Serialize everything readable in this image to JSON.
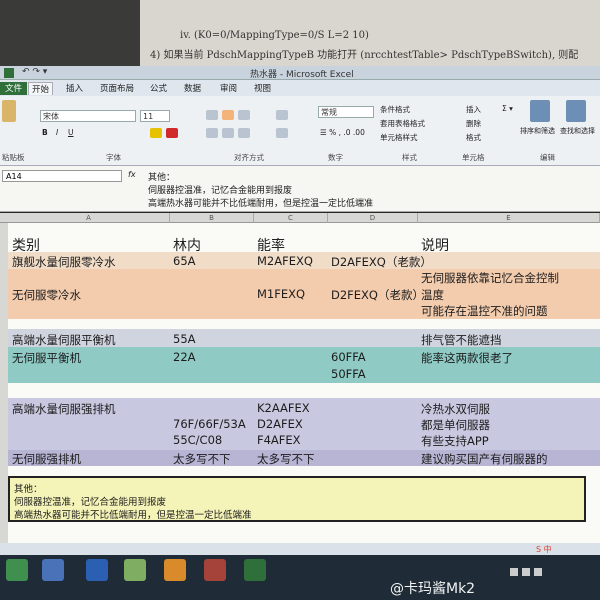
{
  "word": {
    "line1": "iv.       (K0=0/MappingType=0/S L=2 10)",
    "line2": "4) 如果当前 PdschMappingTypeB 功能打开 (nrcchtestTable> PdschTypeBSwitch), 则配"
  },
  "excel": {
    "title": "热水器 - Microsoft Excel",
    "tabs": [
      "文件",
      "开始",
      "插入",
      "页面布局",
      "公式",
      "数据",
      "审阅",
      "视图"
    ],
    "font_name": "宋体",
    "font_size": "11",
    "number_format": "常规",
    "ribbon_items": {
      "cond_format": "条件格式",
      "table_format": "套用表格格式",
      "cell_style": "单元格样式",
      "insert": "插入",
      "delete": "删除",
      "format": "格式",
      "sort_filter": "排序和筛选",
      "find_select": "查找和选择"
    },
    "groups": [
      "粘贴板",
      "字体",
      "对齐方式",
      "数字",
      "样式",
      "单元格",
      "编辑"
    ],
    "name_box": "A14",
    "fx": "fx",
    "formula_lines": [
      "其他：",
      "伺服器控温准，记忆合金能用到报废",
      "高端热水器可能并不比低端耐用，但是控温一定比低端准"
    ],
    "columns": [
      "A",
      "B",
      "C",
      "D",
      "E"
    ]
  },
  "table": {
    "headers": [
      "类别",
      "林内",
      "能率",
      "",
      "说明"
    ],
    "rows": [
      {
        "cat": "旗舰水量伺服零冷水",
        "b": "65A",
        "c": "M2AFEXQ",
        "d": "D2AFEXQ（老款）",
        "e": ""
      },
      {
        "cat": "",
        "b": "",
        "c": "",
        "d": "",
        "e": "无伺服器依靠记忆合金控制"
      },
      {
        "cat": "无伺服零冷水",
        "b": "",
        "c": "M1FEXQ",
        "d": "D2FEXQ（老款）",
        "e": "温度"
      },
      {
        "cat": "",
        "b": "",
        "c": "",
        "d": "",
        "e": "可能存在温控不准的问题"
      },
      {
        "cat": "高端水量伺服平衡机",
        "b": "55A",
        "c": "",
        "d": "",
        "e": "排气管不能遮挡"
      },
      {
        "cat": "无伺服平衡机",
        "b": "22A",
        "c": "",
        "d": "60FFA",
        "e": "能率这两款很老了"
      },
      {
        "cat": "",
        "b": "",
        "c": "",
        "d": "50FFA",
        "e": ""
      },
      {
        "cat": "高端水量伺服强排机",
        "b": "",
        "c": "K2AAFEX",
        "d": "",
        "e": "冷热水双伺服"
      },
      {
        "cat": "",
        "b": "76F/66F/53A",
        "c": "D2AFEX",
        "d": "",
        "e": "都是单伺服器"
      },
      {
        "cat": "",
        "b": "55C/C08",
        "c": "F4AFEX",
        "d": "",
        "e": "有些支持APP"
      },
      {
        "cat": "无伺服强排机",
        "b": "太多写不下",
        "c": "太多写不下",
        "d": "",
        "e": "建议购买国产有伺服器的"
      }
    ]
  },
  "note": {
    "title": "其他：",
    "line1": "伺服器控温准，记忆合金能用到报废",
    "line2": "高端热水器可能并不比低端耐用，但是控温一定比低端准"
  },
  "taskbar": {
    "tray": "S 中"
  },
  "watermark": "@卡玛酱Mk2",
  "colors": {
    "band_orange": "#f3ccae",
    "band_gray": "#cfd4df",
    "band_teal": "#8fcac4",
    "band_lavender": "#c8c8e0",
    "note_fill": "#f4f3b8",
    "excel_green": "#2e6f3a"
  }
}
